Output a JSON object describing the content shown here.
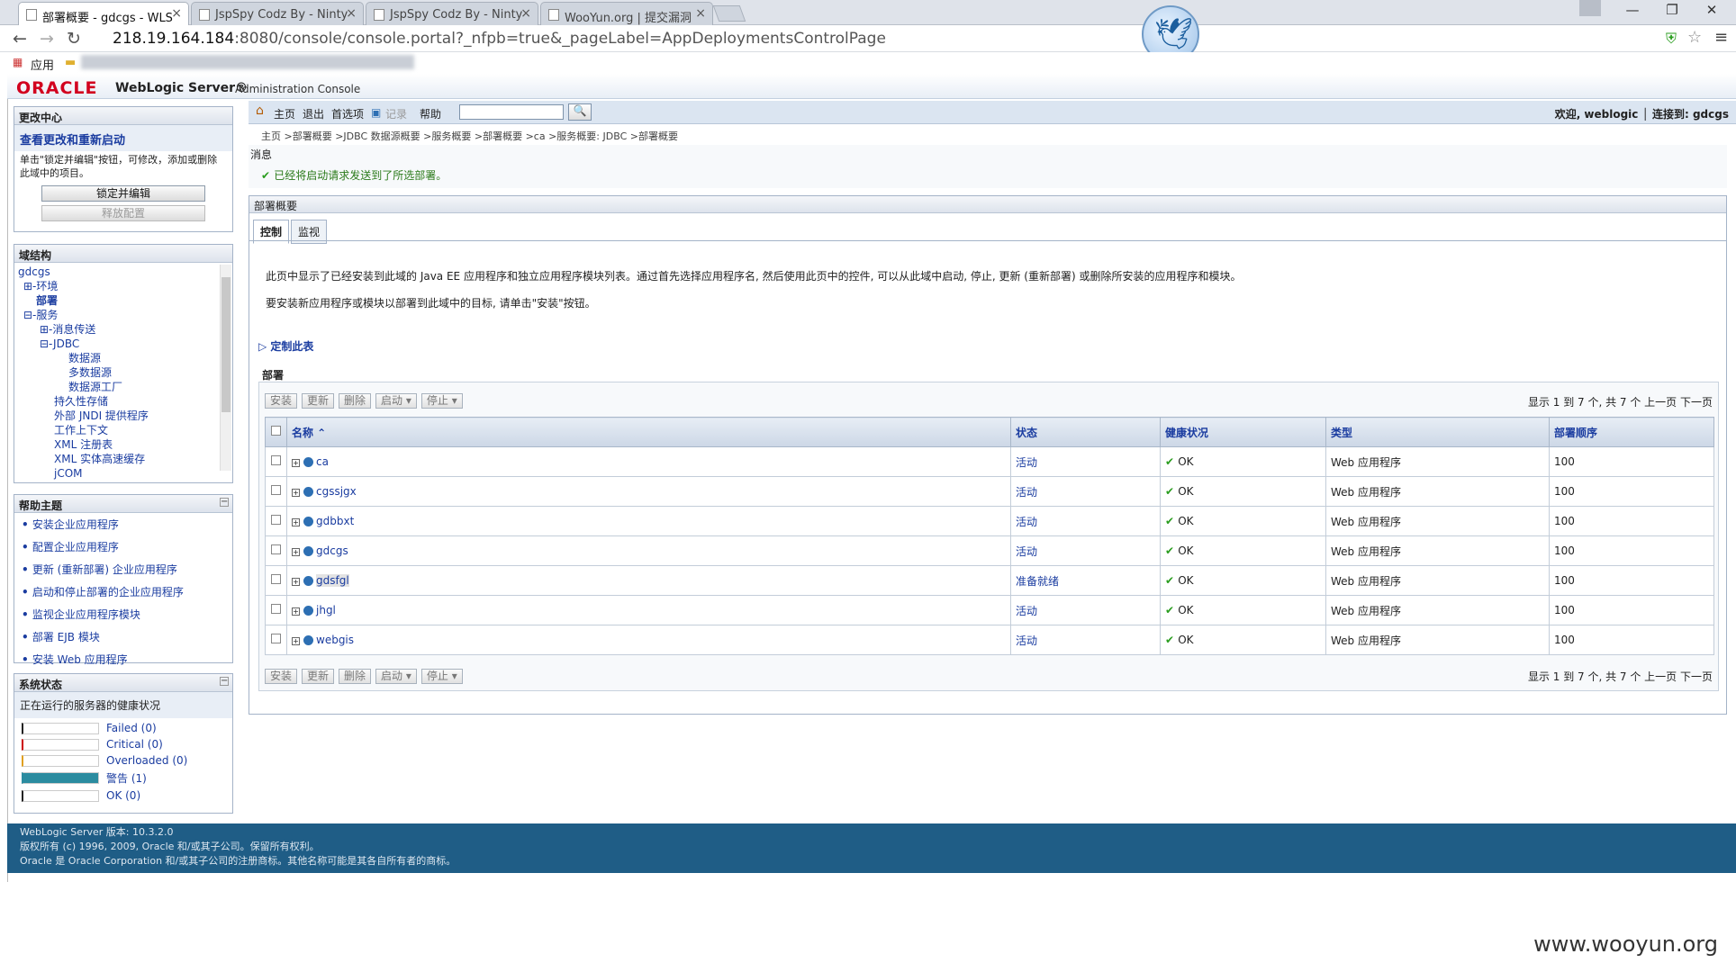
{
  "browser": {
    "tabs": [
      {
        "label": "部署概要 - gdcgs - WLS",
        "close": "×",
        "active": true
      },
      {
        "label": "JspSpy Codz By - Ninty",
        "close": "×"
      },
      {
        "label": "JspSpy Codz By - Ninty",
        "close": "×"
      },
      {
        "label": "WooYun.org | 提交漏洞",
        "close": "×"
      }
    ],
    "window_controls": {
      "min": "—",
      "max": "❐",
      "close": "✕"
    },
    "url_host": "218.19.164.184",
    "url_rest": ":8080/console/console.portal?_nfpb=true&_pageLabel=AppDeploymentsControlPage",
    "bookmarks_apps": "应用"
  },
  "header": {
    "oracle": "ORACLE",
    "product": "WebLogic Server®",
    "subtitle": "Administration Console"
  },
  "change_center": {
    "title": "更改中心",
    "link": "查看更改和重新启动",
    "text": "单击\"锁定并编辑\"按钮，可修改，添加或删除此域中的项目。",
    "lock_button": "锁定并编辑",
    "release_button": "释放配置"
  },
  "domain_structure": {
    "title": "域结构",
    "items": [
      "gdcgs",
      "⊞-环境",
      "部署",
      "⊟-服务",
      "⊞-消息传送",
      "⊟-JDBC",
      "数据源",
      "多数据源",
      "数据源工厂",
      "持久性存储",
      "外部 JNDI 提供程序",
      "工作上下文",
      "XML 注册表",
      "XML 实体高速缓存",
      "jCOM"
    ]
  },
  "help": {
    "title": "帮助主题",
    "items": [
      "安装企业应用程序",
      "配置企业应用程序",
      "更新 (重新部署) 企业应用程序",
      "启动和停止部署的企业应用程序",
      "监视企业应用程序模块",
      "部署 EJB 模块",
      "安装 Web 应用程序"
    ]
  },
  "system_status": {
    "title": "系统状态",
    "subtitle": "正在运行的服务器的健康状况",
    "rows": [
      {
        "label": "Failed (0)",
        "value": 0
      },
      {
        "label": "Critical (0)",
        "value": 0
      },
      {
        "label": "Overloaded (0)",
        "value": 0
      },
      {
        "label": "警告 (1)",
        "value": 1
      },
      {
        "label": "OK (0)",
        "value": 0
      }
    ]
  },
  "toolbar": {
    "home": "主页",
    "logout": "退出",
    "prefs": "首选项",
    "record": "记录",
    "help": "帮助",
    "search_go": "🔍",
    "welcome": "欢迎, weblogic │ 连接到: gdcgs"
  },
  "breadcrumb": "主页 >部署概要 >JDBC 数据源概要 >服务概要 >部署概要 >ca >服务概要: JDBC >部署概要",
  "messages": {
    "title": "消息",
    "text": "已经将启动请求发送到了所选部署。"
  },
  "main": {
    "title": "部署概要",
    "tabs": [
      "控制",
      "监视"
    ],
    "desc1": "此页中显示了已经安装到此域的 Java EE 应用程序和独立应用程序模块列表。通过首先选择应用程序名, 然后使用此页中的控件, 可以从此域中启动, 停止, 更新 (重新部署) 或删除所安装的应用程序和模块。",
    "desc2": "要安装新应用程序或模块以部署到此域中的目标, 请单击\"安装\"按钮。",
    "customize": "定制此表",
    "table_title": "部署",
    "buttons": {
      "install": "安装",
      "update": "更新",
      "delete": "删除",
      "start": "启动 ▾",
      "stop": "停止 ▾"
    },
    "pager": "显示 1 到 7 个, 共 7 个   上一页   下一页",
    "columns": [
      "名称 ⌃",
      "状态",
      "健康状况",
      "类型",
      "部署顺序"
    ],
    "rows": [
      {
        "name": "ca",
        "state": "活动",
        "health": "OK",
        "type": "Web 应用程序",
        "order": "100"
      },
      {
        "name": "cgssjgx",
        "state": "活动",
        "health": "OK",
        "type": "Web 应用程序",
        "order": "100"
      },
      {
        "name": "gdbbxt",
        "state": "活动",
        "health": "OK",
        "type": "Web 应用程序",
        "order": "100"
      },
      {
        "name": "gdcgs",
        "state": "活动",
        "health": "OK",
        "type": "Web 应用程序",
        "order": "100"
      },
      {
        "name": "gdsfgl",
        "state": "准备就绪",
        "health": "OK",
        "type": "Web 应用程序",
        "order": "100"
      },
      {
        "name": "jhgl",
        "state": "活动",
        "health": "OK",
        "type": "Web 应用程序",
        "order": "100"
      },
      {
        "name": "webgis",
        "state": "活动",
        "health": "OK",
        "type": "Web 应用程序",
        "order": "100"
      }
    ]
  },
  "footer": {
    "line1": "WebLogic Server 版本: 10.3.2.0",
    "line2": "版权所有 (c) 1996, 2009, Oracle 和/或其子公司。保留所有权利。",
    "line3": "Oracle 是 Oracle Corporation 和/或其子公司的注册商标。其他名称可能是其各自所有者的商标。"
  },
  "watermark": "www.wooyun.org"
}
